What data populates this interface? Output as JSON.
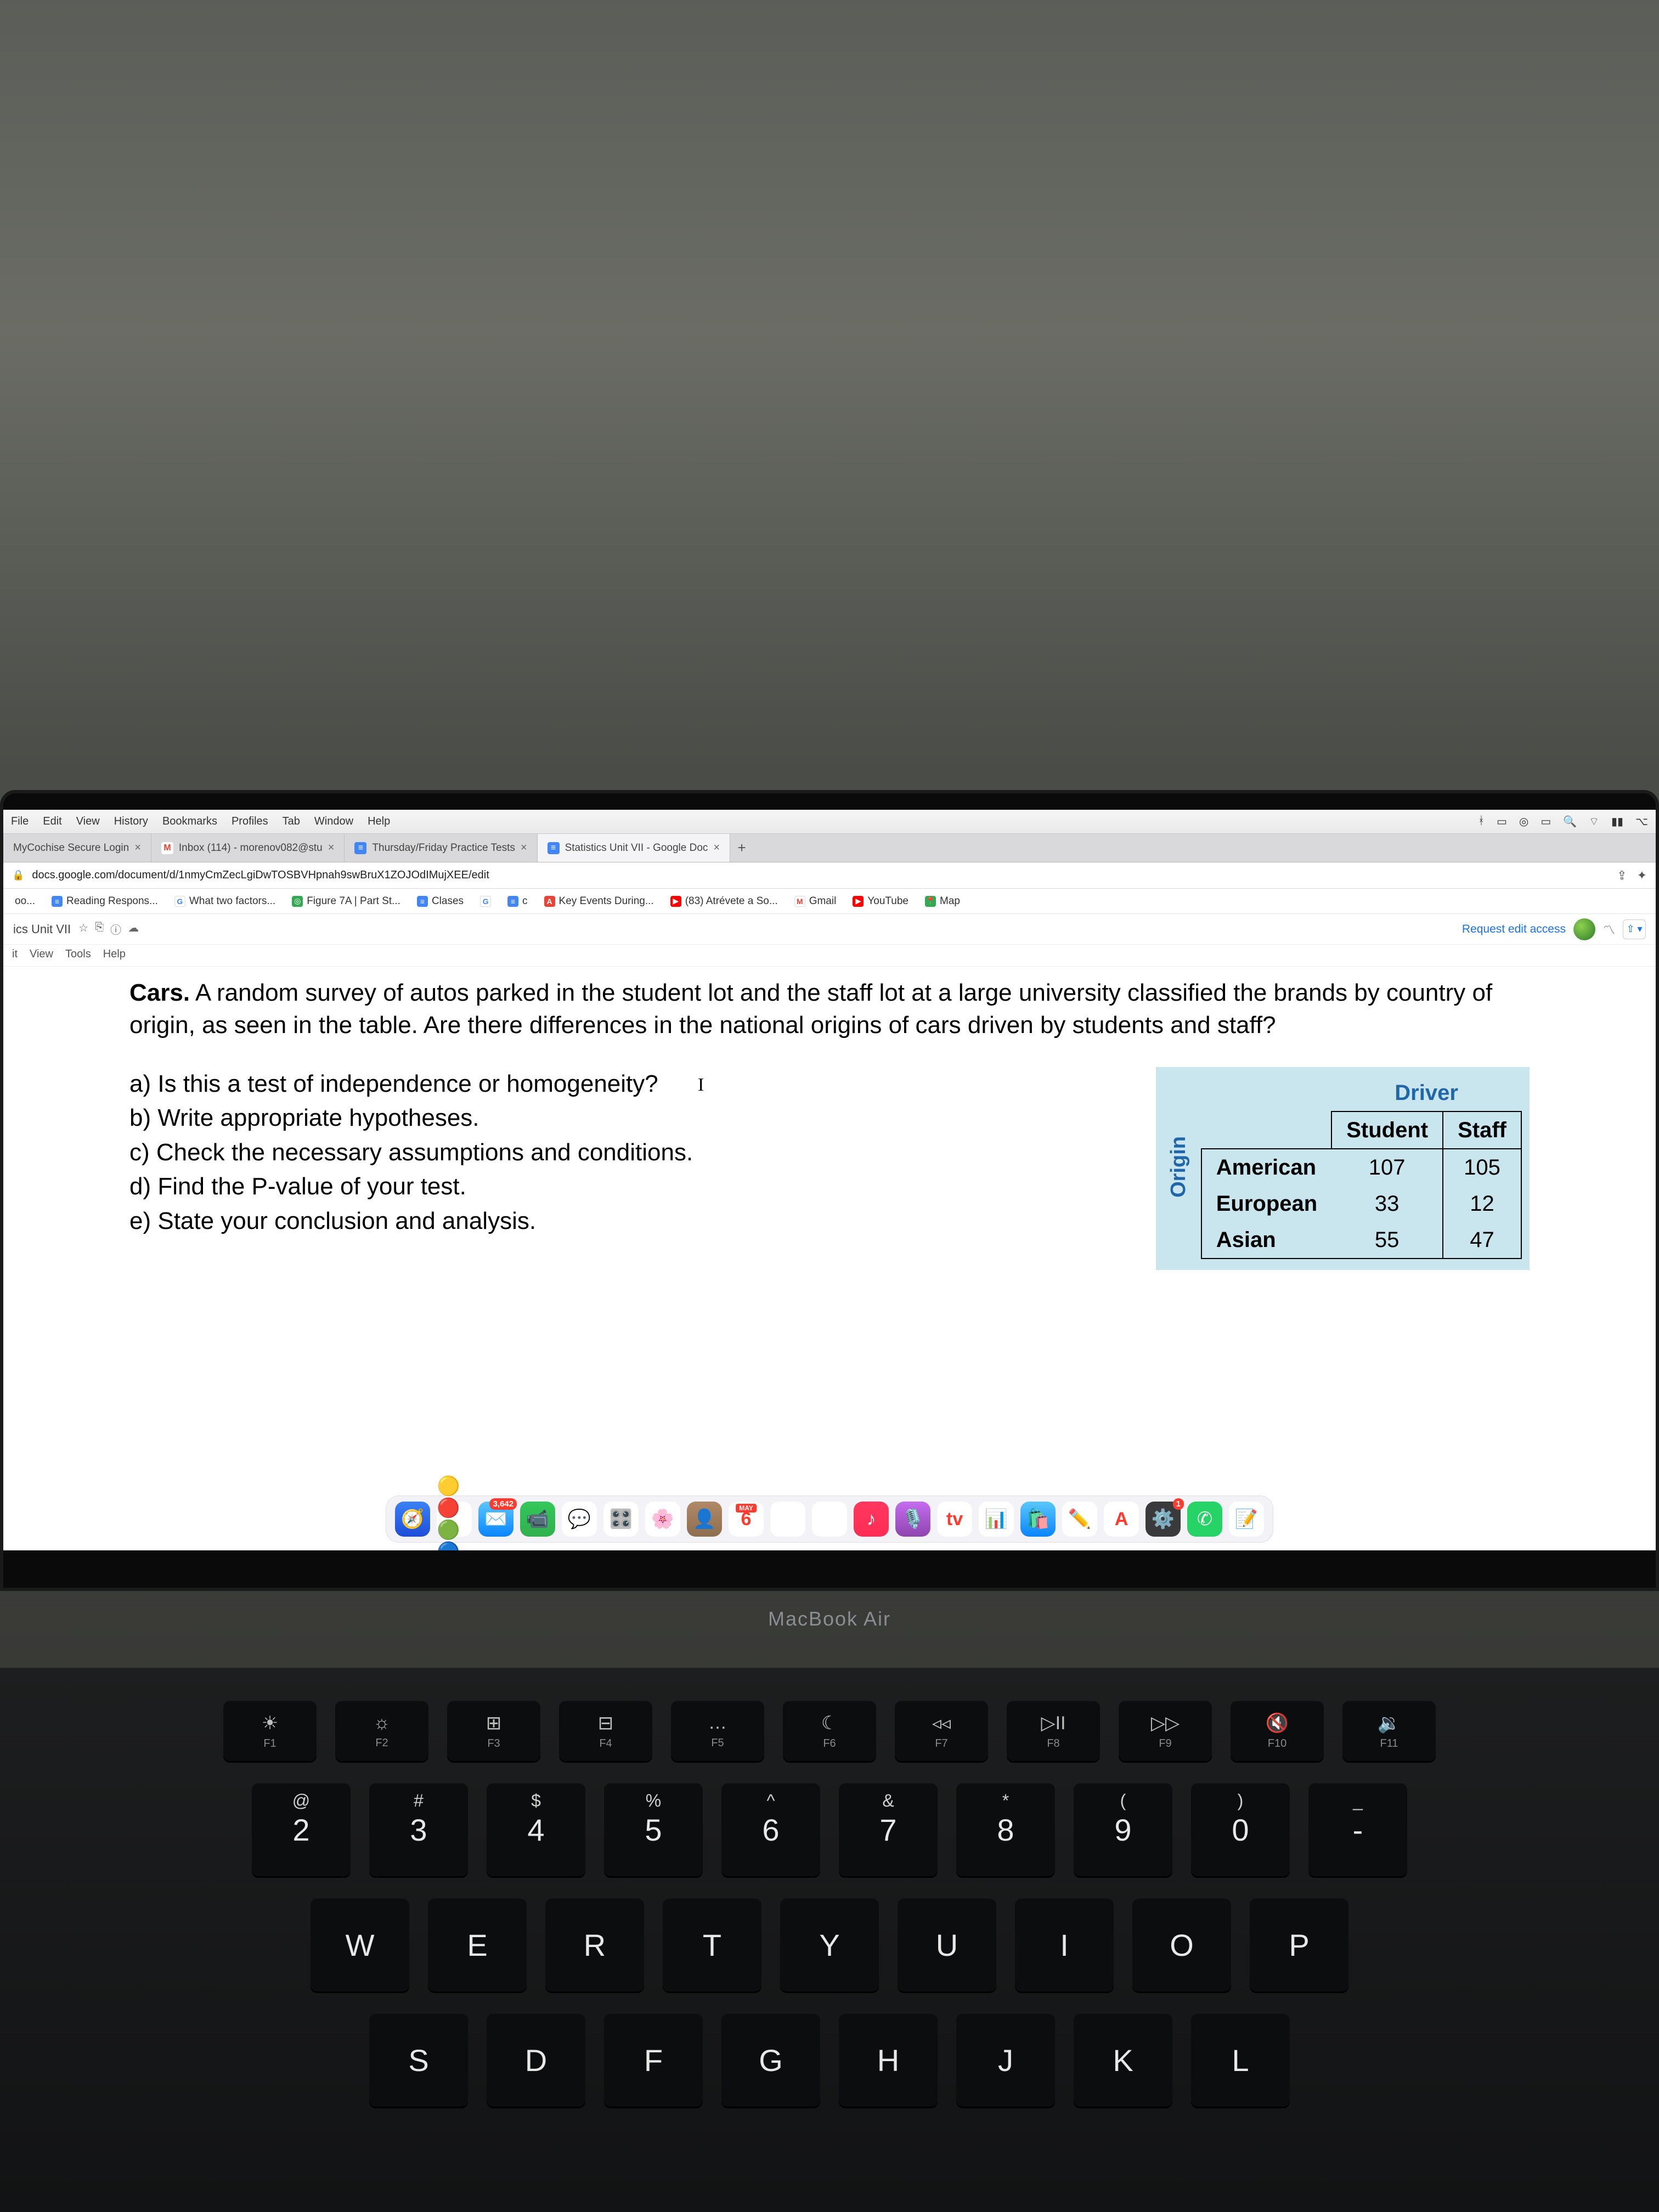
{
  "menubar": {
    "items": [
      "File",
      "Edit",
      "View",
      "History",
      "Bookmarks",
      "Profiles",
      "Tab",
      "Window",
      "Help"
    ]
  },
  "tabs": [
    {
      "label": "MyCochise Secure Login",
      "icon": "",
      "active": false
    },
    {
      "label": "Inbox (114) - morenov082@stu",
      "icon": "M",
      "iconbg": "#ea4335",
      "active": false
    },
    {
      "label": "Thursday/Friday Practice Tests",
      "icon": "📄",
      "iconbg": "#4285f4",
      "active": false
    },
    {
      "label": "Statistics Unit VII - Google Doc",
      "icon": "≡",
      "iconbg": "#4285f4",
      "active": true
    }
  ],
  "url": "docs.google.com/document/d/1nmyCmZecLgiDwTOSBVHpnah9swBruX1ZOJOdIMujXEE/edit",
  "bookmarks": [
    {
      "label": "oo...",
      "ic": "",
      "bg": "#888"
    },
    {
      "label": "Reading Respons...",
      "ic": "📄",
      "bg": "#4285f4"
    },
    {
      "label": "What two factors...",
      "ic": "G",
      "bg": "#fff",
      "fg": "#4285f4"
    },
    {
      "label": "Figure 7A | Part St...",
      "ic": "◎",
      "bg": "#34a853"
    },
    {
      "label": "Clases",
      "ic": "📄",
      "bg": "#4285f4"
    },
    {
      "label": "",
      "ic": "G",
      "bg": "#fff",
      "fg": "#4285f4"
    },
    {
      "label": "c",
      "ic": "≡",
      "bg": "#4285f4"
    },
    {
      "label": "Key Events During...",
      "ic": "A",
      "bg": "#ea4335"
    },
    {
      "label": "(83) Atrévete a So...",
      "ic": "▶",
      "bg": "#ff0000"
    },
    {
      "label": "Gmail",
      "ic": "M",
      "bg": "#fff",
      "fg": "#ea4335"
    },
    {
      "label": "YouTube",
      "ic": "▶",
      "bg": "#ff0000"
    },
    {
      "label": "Map",
      "ic": "📍",
      "bg": "#34a853"
    }
  ],
  "doc": {
    "title": "ics Unit VII",
    "menu": [
      "it",
      "View",
      "Tools",
      "Help"
    ],
    "request": "Request edit access"
  },
  "body": {
    "lead_bold": "Cars.",
    "lead": " A random survey of autos parked in the student lot and the staff lot at a large university classified the brands by country of origin, as seen in the table. Are there differences in the national origins of cars driven by students and staff?",
    "qa": "a) Is this a test of independence or homogeneity?",
    "qb": "b) Write appropriate hypotheses.",
    "qc": "c) Check the necessary assumptions and conditions.",
    "qd": "d) Find the P-value of your test.",
    "qe": "e) State your conclusion and analysis."
  },
  "chart_data": {
    "type": "table",
    "title": "Driver",
    "row_axis": "Origin",
    "columns": [
      "Student",
      "Staff"
    ],
    "rows": [
      "American",
      "European",
      "Asian"
    ],
    "values": [
      [
        107,
        105
      ],
      [
        33,
        12
      ],
      [
        55,
        47
      ]
    ]
  },
  "dock": [
    {
      "bg": "linear-gradient(#3b82f6,#1d4ed8)",
      "glyph": "🧭"
    },
    {
      "bg": "#fff",
      "glyph": "🟡🔴🟢🔵",
      "txt": ""
    },
    {
      "bg": "linear-gradient(#5ac8fa,#0a84ff)",
      "glyph": "✉️",
      "badge": "3,642"
    },
    {
      "bg": "linear-gradient(#34c759,#30b14e)",
      "glyph": "📹"
    },
    {
      "bg": "#fff",
      "glyph": "💬"
    },
    {
      "bg": "#fff",
      "glyph": "🎛️"
    },
    {
      "bg": "#fff",
      "glyph": "🌸"
    },
    {
      "bg": "linear-gradient(#b08968,#8d6e4f)",
      "glyph": "👤"
    },
    {
      "bg": "#fff",
      "glyph": "6",
      "badge_top": "MAY"
    },
    {
      "bg": "#fff",
      "glyph": "⋮≡"
    },
    {
      "bg": "#fff",
      "glyph": ""
    },
    {
      "bg": "linear-gradient(#ff375f,#ff2d55)",
      "glyph": "♪"
    },
    {
      "bg": "linear-gradient(#c56cf0,#8e44ad)",
      "glyph": "🎙️"
    },
    {
      "bg": "#000",
      "glyph": "tv"
    },
    {
      "bg": "#fff",
      "glyph": "📊"
    },
    {
      "bg": "linear-gradient(#5ac8fa,#0a84ff)",
      "glyph": "🛍️"
    },
    {
      "bg": "#fff",
      "glyph": "✏️"
    },
    {
      "bg": "linear-gradient(#dbeafe,#93c5fd)",
      "glyph": "A"
    },
    {
      "bg": "#3a3a3c",
      "glyph": "⚙️",
      "badge": "1"
    },
    {
      "bg": "#25d366",
      "glyph": "✆"
    },
    {
      "bg": "#fff",
      "glyph": "📝"
    }
  ],
  "deck": "MacBook Air",
  "fnrow": [
    {
      "sym": "☀︎",
      "lab": "F1"
    },
    {
      "sym": "☼",
      "lab": "F2"
    },
    {
      "sym": "⊞",
      "lab": "F3"
    },
    {
      "sym": "⊟",
      "lab": "F4"
    },
    {
      "sym": "…",
      "lab": "F5"
    },
    {
      "sym": "☾",
      "lab": "F6"
    },
    {
      "sym": "◃◃",
      "lab": "F7"
    },
    {
      "sym": "▷II",
      "lab": "F8"
    },
    {
      "sym": "▷▷",
      "lab": "F9"
    },
    {
      "sym": "🔇",
      "lab": "F10"
    },
    {
      "sym": "🔉",
      "lab": "F11"
    }
  ],
  "numrow": [
    {
      "top": "@",
      "main": "2"
    },
    {
      "top": "#",
      "main": "3"
    },
    {
      "top": "$",
      "main": "4"
    },
    {
      "top": "%",
      "main": "5"
    },
    {
      "top": "^",
      "main": "6"
    },
    {
      "top": "&",
      "main": "7"
    },
    {
      "top": "*",
      "main": "8"
    },
    {
      "top": "(",
      "main": "9"
    },
    {
      "top": ")",
      "main": "0"
    },
    {
      "top": "_",
      "main": "-"
    }
  ],
  "qrow": [
    "W",
    "E",
    "R",
    "T",
    "Y",
    "U",
    "I",
    "O",
    "P"
  ],
  "arow": [
    "S",
    "D",
    "F",
    "G",
    "H",
    "J",
    "K",
    "L"
  ]
}
